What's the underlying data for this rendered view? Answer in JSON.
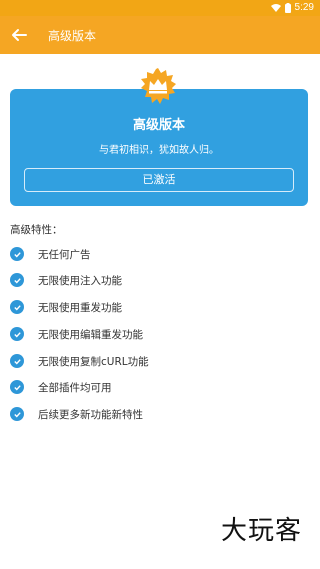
{
  "status_bar": {
    "time": "5:29",
    "icons": [
      "wifi-icon",
      "battery-icon"
    ]
  },
  "app_bar": {
    "title": "高级版本",
    "back_icon": "arrow-left-icon",
    "color": "#f5a623"
  },
  "premium_card": {
    "badge_icon": "crown-badge-icon",
    "title": "高级版本",
    "subtitle": "与君初相识，犹如故人归。",
    "button_label": "已激活",
    "color": "#31a0e0"
  },
  "features": {
    "title": "高级特性：",
    "items": [
      "无任何广告",
      "无限使用注入功能",
      "无限使用重发功能",
      "无限使用编辑重发功能",
      "无限使用复制cURL功能",
      "全部插件均可用",
      "后续更多新功能新特性"
    ]
  },
  "watermark": "大玩客"
}
